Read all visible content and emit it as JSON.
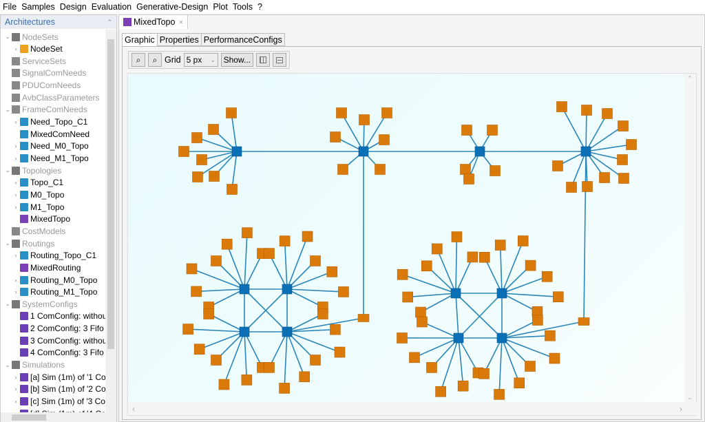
{
  "menu": [
    "File",
    "Samples",
    "Design",
    "Evaluation",
    "Generative-Design",
    "Plot",
    "Tools",
    "?"
  ],
  "sidebar": {
    "title": "Architectures",
    "items": [
      {
        "label": "NodeSets",
        "level": 0,
        "cat": true,
        "tw": "v",
        "icon": "#777"
      },
      {
        "label": "NodeSet",
        "level": 1,
        "cat": false,
        "tw": ">",
        "icon": "#f0a020"
      },
      {
        "label": "ServiceSets",
        "level": 0,
        "cat": true,
        "tw": "",
        "icon": "#888"
      },
      {
        "label": "SignalComNeeds",
        "level": 0,
        "cat": true,
        "tw": "",
        "icon": "#888"
      },
      {
        "label": "PDUComNeeds",
        "level": 0,
        "cat": true,
        "tw": "",
        "icon": "#888"
      },
      {
        "label": "AvbClassParameters",
        "level": 0,
        "cat": true,
        "tw": "",
        "icon": "#888"
      },
      {
        "label": "FrameComNeeds",
        "level": 0,
        "cat": true,
        "tw": "v",
        "icon": "#888"
      },
      {
        "label": "Need_Topo_C1",
        "level": 1,
        "cat": false,
        "tw": ">",
        "icon": "#2a8fc7"
      },
      {
        "label": "MixedComNeed",
        "level": 1,
        "cat": false,
        "tw": "",
        "icon": "#2a8fc7"
      },
      {
        "label": "Need_M0_Topo",
        "level": 1,
        "cat": false,
        "tw": ">",
        "icon": "#2a8fc7"
      },
      {
        "label": "Need_M1_Topo",
        "level": 1,
        "cat": false,
        "tw": ">",
        "icon": "#2a8fc7"
      },
      {
        "label": "Topologies",
        "level": 0,
        "cat": true,
        "tw": "v",
        "icon": "#777"
      },
      {
        "label": "Topo_C1",
        "level": 1,
        "cat": false,
        "tw": ">",
        "icon": "#2a8fc7"
      },
      {
        "label": "M0_Topo",
        "level": 1,
        "cat": false,
        "tw": ">",
        "icon": "#2a8fc7"
      },
      {
        "label": "M1_Topo",
        "level": 1,
        "cat": false,
        "tw": ">",
        "icon": "#2a8fc7"
      },
      {
        "label": "MixedTopo",
        "level": 1,
        "cat": false,
        "tw": "",
        "icon": "#7b3fb5"
      },
      {
        "label": "CostModels",
        "level": 0,
        "cat": true,
        "tw": "",
        "icon": "#888"
      },
      {
        "label": "Routings",
        "level": 0,
        "cat": true,
        "tw": "v",
        "icon": "#777"
      },
      {
        "label": "Routing_Topo_C1",
        "level": 1,
        "cat": false,
        "tw": ">",
        "icon": "#2a8fc7"
      },
      {
        "label": "MixedRouting",
        "level": 1,
        "cat": false,
        "tw": "",
        "icon": "#7b3fb5"
      },
      {
        "label": "Routing_M0_Topo",
        "level": 1,
        "cat": false,
        "tw": ">",
        "icon": "#2a8fc7"
      },
      {
        "label": "Routing_M1_Topo",
        "level": 1,
        "cat": false,
        "tw": ">",
        "icon": "#2a8fc7"
      },
      {
        "label": "SystemConfigs",
        "level": 0,
        "cat": true,
        "tw": "v",
        "icon": "#777"
      },
      {
        "label": "1 ComConfig: withou",
        "level": 1,
        "cat": false,
        "tw": "",
        "icon": "#6a3fb5"
      },
      {
        "label": "2 ComConfig: 3 Fifo",
        "level": 1,
        "cat": false,
        "tw": "",
        "icon": "#6a3fb5"
      },
      {
        "label": "3 ComConfig: withou",
        "level": 1,
        "cat": false,
        "tw": "",
        "icon": "#6a3fb5"
      },
      {
        "label": "4 ComConfig: 3 Fifo",
        "level": 1,
        "cat": false,
        "tw": "",
        "icon": "#6a3fb5"
      },
      {
        "label": "Simulations",
        "level": 0,
        "cat": true,
        "tw": "v",
        "icon": "#777"
      },
      {
        "label": "[a] Sim (1m) of '1 Co",
        "level": 1,
        "cat": false,
        "tw": ">",
        "icon": "#6a3fb5"
      },
      {
        "label": "[b] Sim (1m) of '2 Co",
        "level": 1,
        "cat": false,
        "tw": ">",
        "icon": "#6a3fb5"
      },
      {
        "label": "[c] Sim (1m) of '3 Co",
        "level": 1,
        "cat": false,
        "tw": ">",
        "icon": "#6a3fb5"
      },
      {
        "label": "[d] Sim (1m) of '4 Co",
        "level": 1,
        "cat": false,
        "tw": ">",
        "icon": "#6a3fb5"
      }
    ]
  },
  "editor": {
    "tab": "MixedTopo",
    "close": "✕",
    "subtabs": [
      "Graphic",
      "Properties",
      "PerformanceConfigs"
    ],
    "active_subtab": "Graphic",
    "toolbar": {
      "zoom_in": "⌕",
      "zoom_out": "⌕",
      "grid_label": "Grid",
      "grid_value": "5 px",
      "show": "Show..."
    }
  },
  "colors": {
    "device": "#d97a0a",
    "switch": "#0a6fb5",
    "link": "#2a86b8",
    "canvas": "#eefcfd"
  }
}
